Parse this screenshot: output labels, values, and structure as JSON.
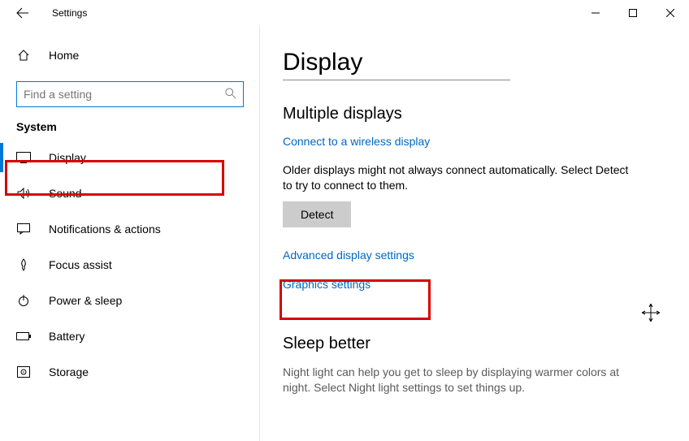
{
  "window": {
    "title": "Settings"
  },
  "sidebar": {
    "home": "Home",
    "search_placeholder": "Find a setting",
    "section": "System",
    "items": [
      {
        "label": "Display"
      },
      {
        "label": "Sound"
      },
      {
        "label": "Notifications & actions"
      },
      {
        "label": "Focus assist"
      },
      {
        "label": "Power & sleep"
      },
      {
        "label": "Battery"
      },
      {
        "label": "Storage"
      }
    ]
  },
  "main": {
    "title": "Display",
    "multi_heading": "Multiple displays",
    "connect_link": "Connect to a wireless display",
    "detect_desc": "Older displays might not always connect automatically. Select Detect to try to connect to them.",
    "detect_btn": "Detect",
    "adv_link": "Advanced display settings",
    "graphics_link": "Graphics settings",
    "sleep_heading": "Sleep better",
    "sleep_desc": "Night light can help you get to sleep by displaying warmer colors at night. Select Night light settings to set things up."
  }
}
